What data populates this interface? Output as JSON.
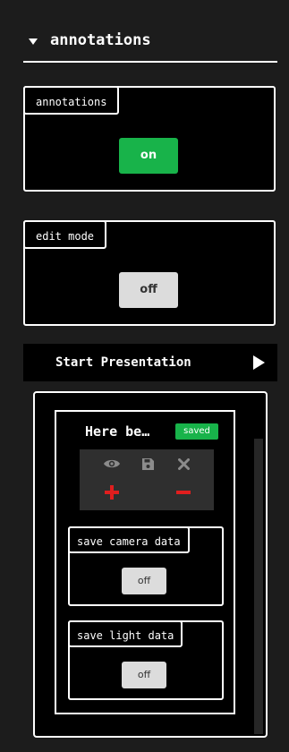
{
  "header": {
    "title": "annotations"
  },
  "toggles": [
    {
      "label": "annotations",
      "state": "on"
    },
    {
      "label": "edit mode",
      "state": "off"
    }
  ],
  "presentation": {
    "label": "Start Presentation"
  },
  "annotation_card": {
    "name": "Here be…",
    "status": "saved",
    "tools": [
      "eye-icon",
      "save-icon",
      "close-icon",
      "plus-icon",
      "minus-icon"
    ],
    "toggles": [
      {
        "label": "save camera data",
        "state": "off"
      },
      {
        "label": "save light data",
        "state": "off"
      }
    ]
  },
  "colors": {
    "accent_green": "#18b34a",
    "danger_red": "#e01e1e",
    "background": "#1c1c1c"
  }
}
